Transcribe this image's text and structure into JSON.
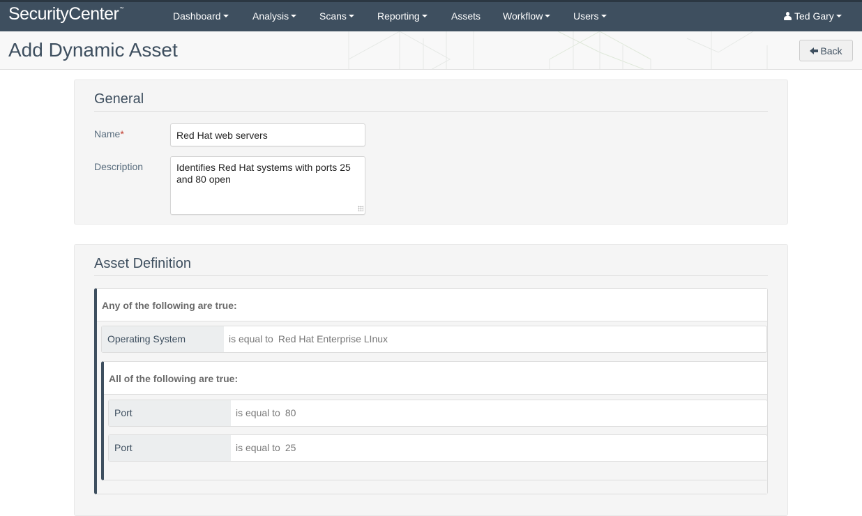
{
  "app": {
    "brand": "SecurityCenter",
    "brand_mark": "™"
  },
  "nav": {
    "items": [
      {
        "label": "Dashboard",
        "has_dropdown": true
      },
      {
        "label": "Analysis",
        "has_dropdown": true
      },
      {
        "label": "Scans",
        "has_dropdown": true
      },
      {
        "label": "Reporting",
        "has_dropdown": true
      },
      {
        "label": "Assets",
        "has_dropdown": false
      },
      {
        "label": "Workflow",
        "has_dropdown": true
      },
      {
        "label": "Users",
        "has_dropdown": true
      }
    ],
    "user": {
      "label": "Ted Gary",
      "icon": "user-icon"
    }
  },
  "header": {
    "title": "Add Dynamic Asset",
    "back_label": "Back",
    "back_icon": "arrow-left-icon"
  },
  "general": {
    "title": "General",
    "name_label": "Name",
    "required_mark": "*",
    "name_value": "Red Hat web servers",
    "description_label": "Description",
    "description_value": "Identifies Red Hat systems with ports 25 and 80 open"
  },
  "asset_definition": {
    "title": "Asset Definition",
    "outer_group": {
      "heading": "Any of the following are true:",
      "rules": [
        {
          "field": "Operating System",
          "operator": "is equal to",
          "value": "Red Hat Enterprise LInux"
        }
      ],
      "inner_group": {
        "heading": "All of the following are true:",
        "rules": [
          {
            "field": "Port",
            "operator": "is equal to",
            "value": "80"
          },
          {
            "field": "Port",
            "operator": "is equal to",
            "value": "25"
          }
        ]
      }
    }
  },
  "colors": {
    "nav_bg": "#3e4f5f",
    "accent": "#3e4f5f",
    "required": "#c0392b",
    "panel_bg": "#f5f5f5"
  }
}
